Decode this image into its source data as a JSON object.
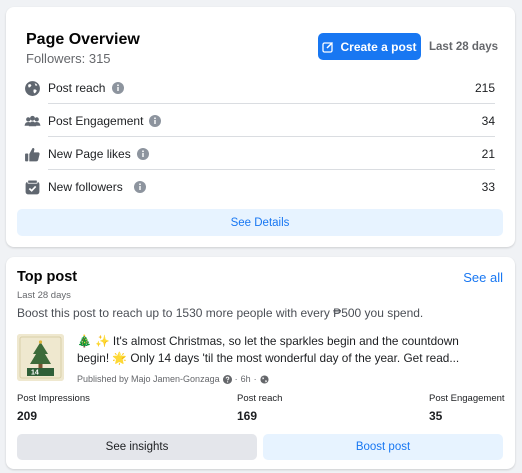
{
  "overview": {
    "title": "Page Overview",
    "followers_text": "Followers: 315",
    "create_post_label": "Create a post",
    "range_label": "Last 28 days",
    "metrics": [
      {
        "label": "Post reach",
        "value": "215",
        "icon": "globe-icon"
      },
      {
        "label": "Post Engagement",
        "value": "34",
        "icon": "people-icon"
      },
      {
        "label": "New Page likes",
        "value": "21",
        "icon": "thumbs-up-icon"
      },
      {
        "label": "New followers",
        "value": "33",
        "icon": "follow-check-icon"
      }
    ],
    "see_details_label": "See Details"
  },
  "top_post": {
    "title": "Top post",
    "see_all_label": "See all",
    "range_label": "Last 28 days",
    "boost_text": "Boost this post to reach up to 1530 more people with every ₱500 you spend.",
    "post_line_1": "🎄 ✨ It's almost Christmas, so let the sparkles begin and the countdown",
    "post_line_2": "begin! 🌟  Only 14 days 'til the most wonderful day of the year. Get read...",
    "thumbnail_number": "14",
    "published_by": "Published by Majo Jamen-Gonzaga",
    "time_ago": "6h",
    "stats": [
      {
        "label": "Post Impressions",
        "value": "209"
      },
      {
        "label": "Post reach",
        "value": "169"
      },
      {
        "label": "Post Engagement",
        "value": "35"
      }
    ],
    "see_insights_label": "See insights",
    "boost_post_label": "Boost post"
  },
  "colors": {
    "accent": "#1877f2",
    "accent_light": "#e7f3ff",
    "background": "#f0f2f5",
    "muted_text": "#65676b"
  }
}
